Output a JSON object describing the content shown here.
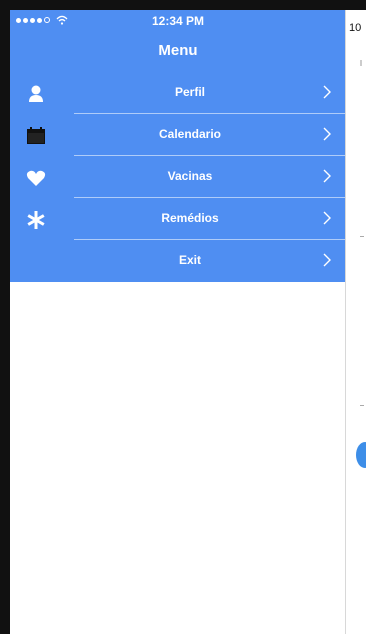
{
  "status_bar": {
    "time": "12:34 PM"
  },
  "menu": {
    "title": "Menu",
    "items": [
      {
        "label": "Perfil",
        "icon": "person-icon"
      },
      {
        "label": "Calendario",
        "icon": "calendar-icon"
      },
      {
        "label": "Vacinas",
        "icon": "heart-icon"
      },
      {
        "label": "Remédios",
        "icon": "asterisk-icon"
      },
      {
        "label": "Exit",
        "icon": ""
      }
    ]
  },
  "background_screen": {
    "time_fragment": "10"
  },
  "colors": {
    "menu_background": "#4f8ef2",
    "text": "#ffffff"
  }
}
